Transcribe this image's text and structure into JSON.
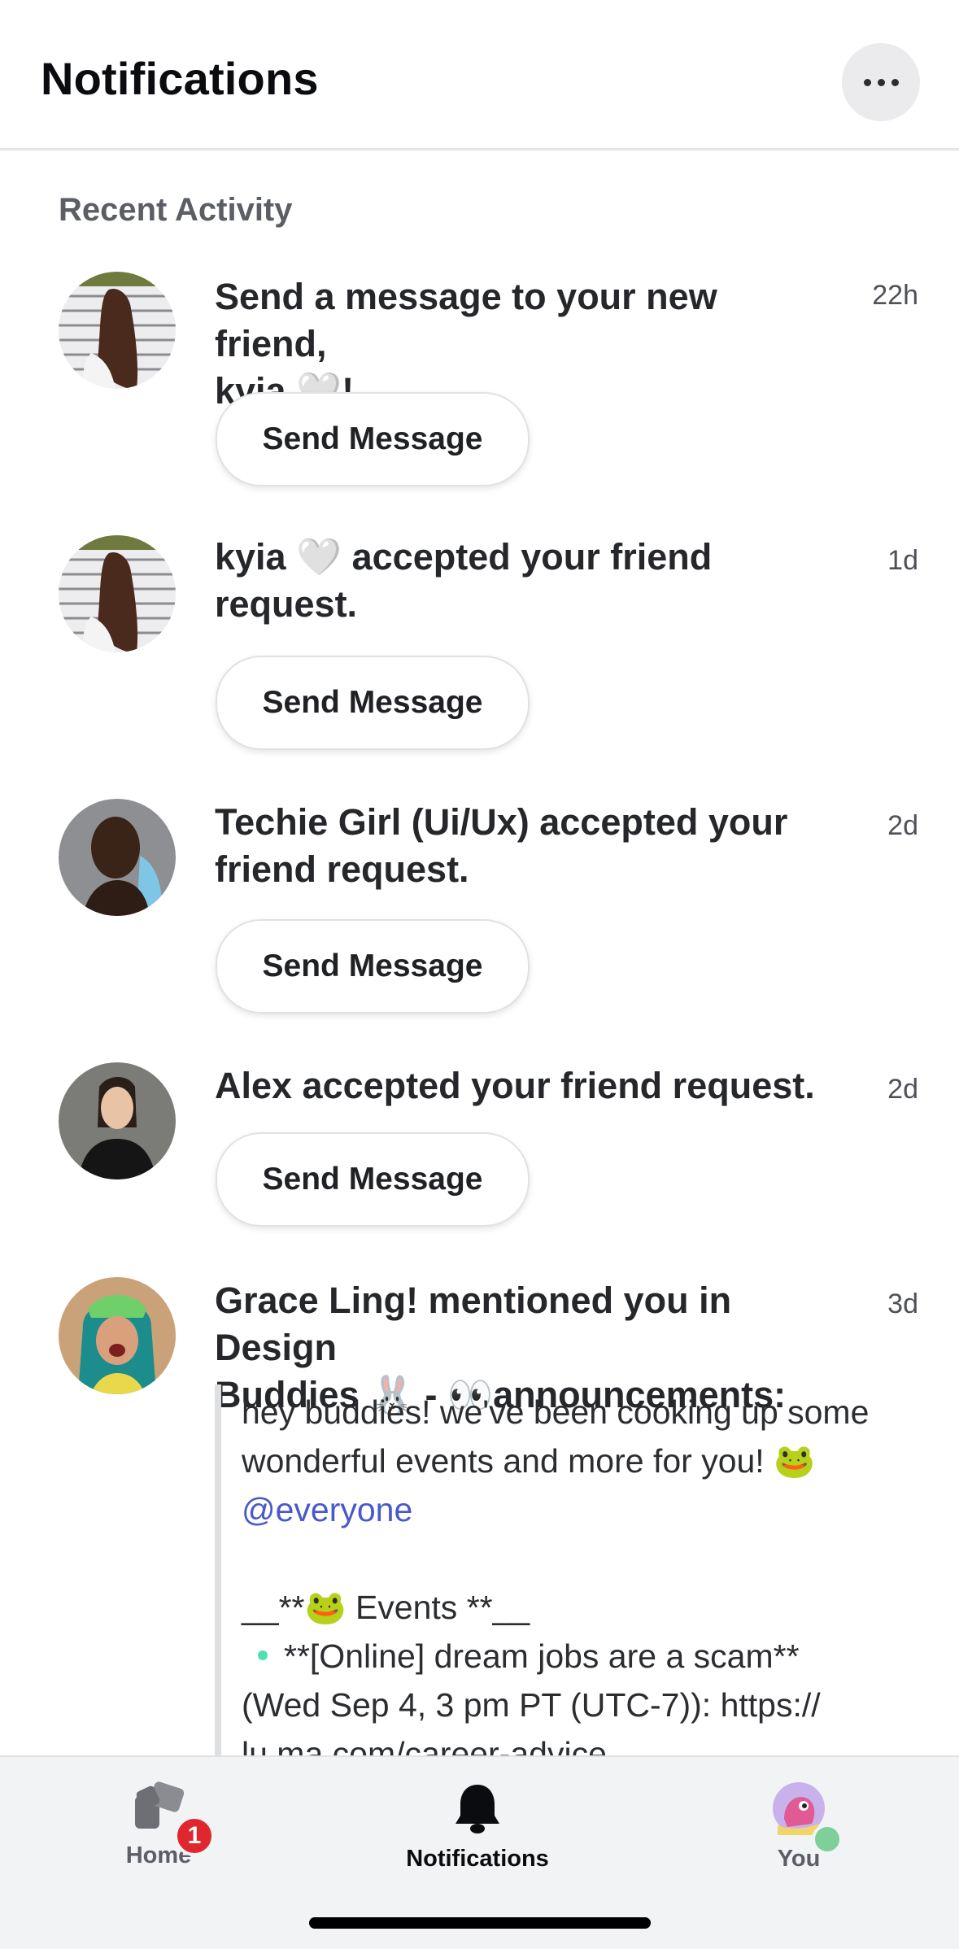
{
  "header": {
    "title": "Notifications",
    "more_icon": "ellipsis-icon"
  },
  "section": {
    "label": "Recent Activity"
  },
  "notifications": [
    {
      "text_line1": "Send a message to your new friend,",
      "text_line2": "kyia 🤍!",
      "time": "22h",
      "button": "Send Message"
    },
    {
      "text_line1": "kyia 🤍 accepted your friend",
      "text_line2": "request.",
      "time": "1d",
      "button": "Send Message"
    },
    {
      "text_line1": "Techie Girl (Ui/Ux) accepted your",
      "text_line2": "friend request.",
      "time": "2d",
      "button": "Send Message"
    },
    {
      "text_line1": "Alex accepted your friend request.",
      "time": "2d",
      "button": "Send Message"
    },
    {
      "text_line1": "Grace Ling! mentioned you in Design",
      "text_line2": "Buddies 🐰 - 👀announcements:",
      "time": "3d",
      "quote": {
        "line1": "hey buddies! we've been cooking up some",
        "line2": "wonderful events and more for you! 🐸",
        "mention": "@everyone",
        "line4": "__**🐸 Events **__",
        "line5": "**[Online] dream jobs are a scam**",
        "line6": "(Wed Sep 4, 3 pm PT (UTC-7)): https://",
        "line7": "lu.ma.com/career-advice"
      }
    }
  ],
  "tabbar": {
    "home_label": "Home",
    "home_badge": "1",
    "notifications_label": "Notifications",
    "you_label": "You"
  }
}
